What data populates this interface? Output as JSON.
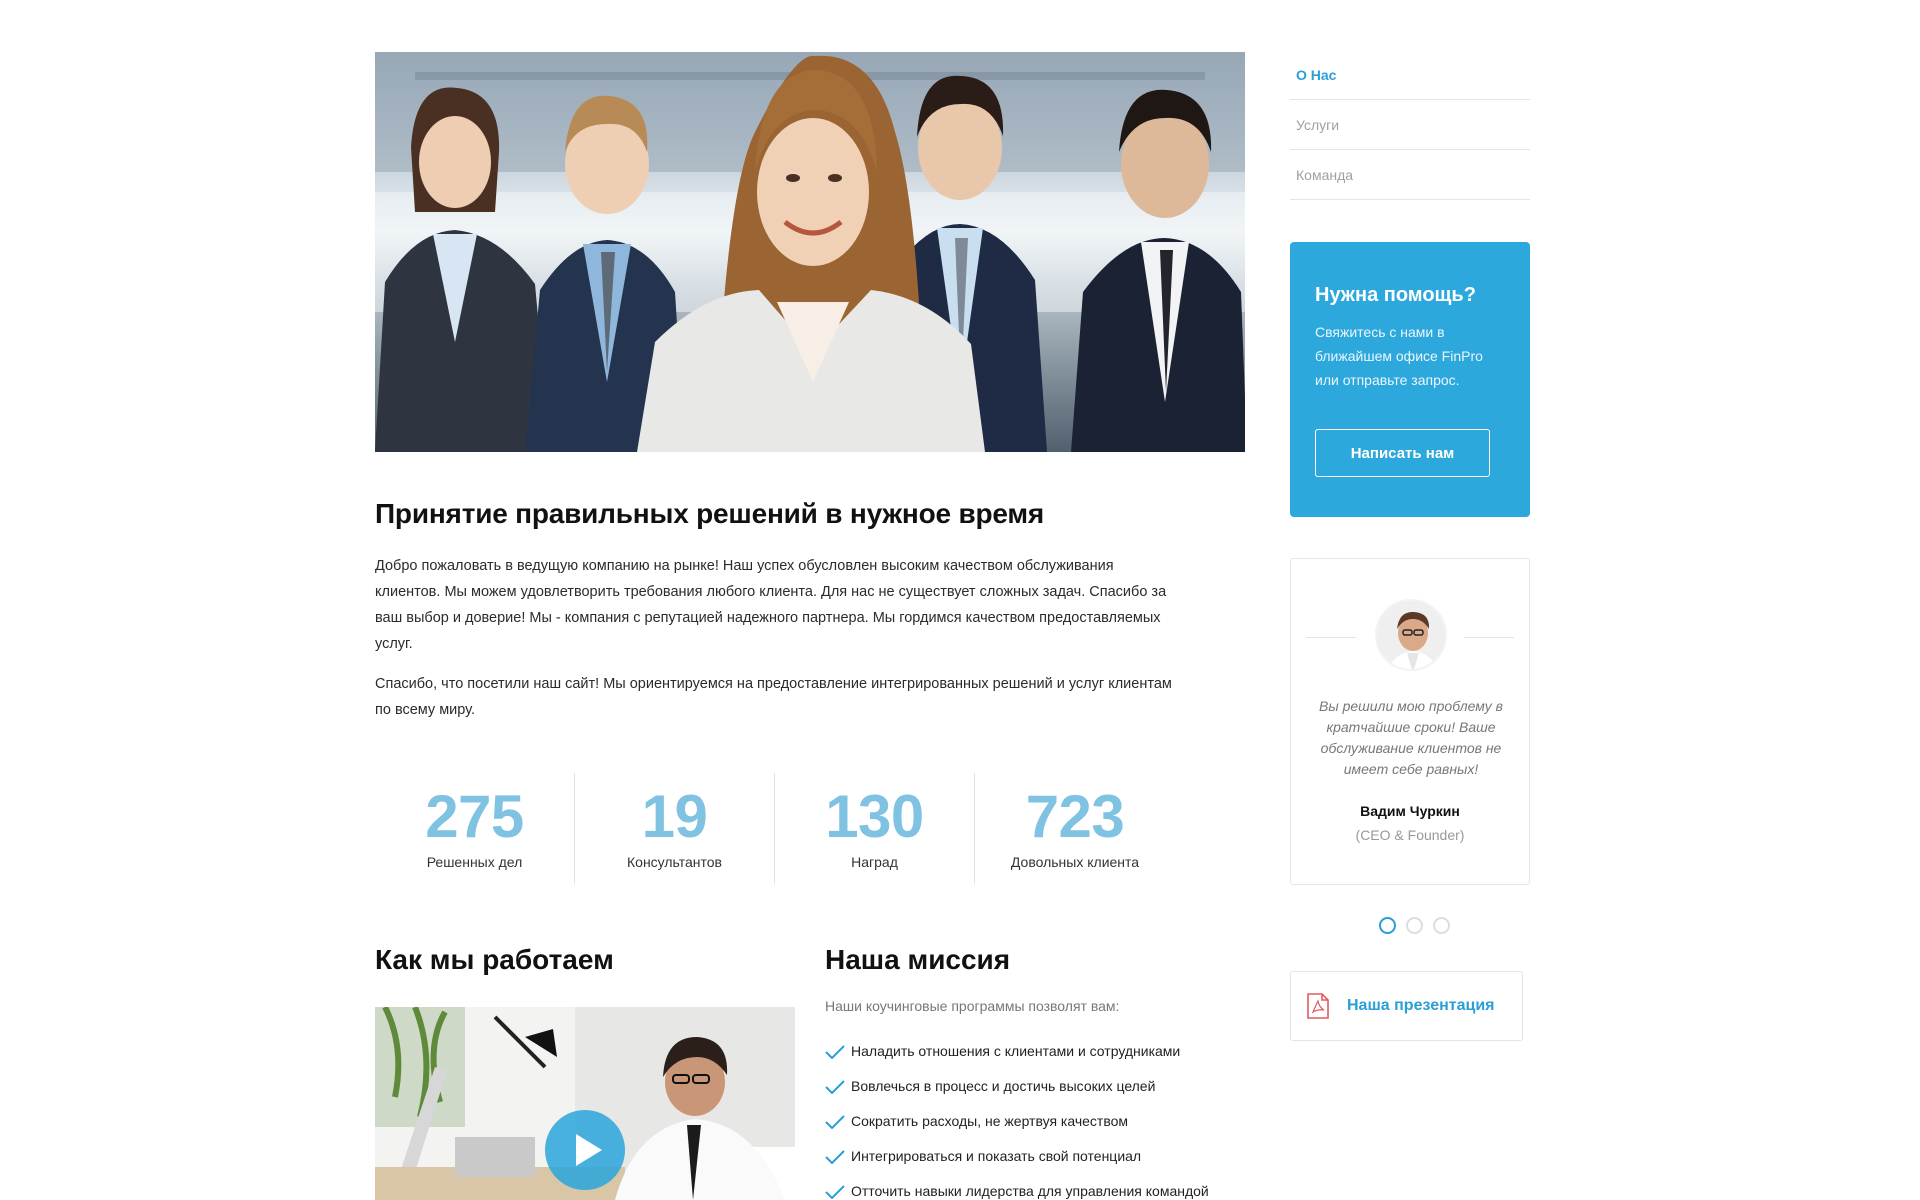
{
  "hero": {
    "image": "team-of-business-people-photo"
  },
  "article": {
    "headline": "Принятие правильных решений в нужное время",
    "paragraph_1": "Добро пожаловать в ведущую компанию на рынке! Наш успех обусловлен высоким качеством обслуживания клиентов. Мы можем удовлетворить требования любого клиента. Для нас не существует сложных задач. Спасибо за ваш выбор и доверие! Мы - компания с репутацией надежного партнера. Мы гордимся качеством предоставляемых услуг.",
    "paragraph_2": "Спасибо, что посетили наш сайт! Мы ориентируемся на предоставление интегрированных решений и услуг клиентам по всему миру."
  },
  "stats": [
    {
      "value": "275",
      "label": "Решенных дел"
    },
    {
      "value": "19",
      "label": "Консультантов"
    },
    {
      "value": "130",
      "label": "Наград"
    },
    {
      "value": "723",
      "label": "Довольных клиента"
    }
  ],
  "how_we_work": {
    "title": "Как мы работаем",
    "video_image": "man-working-at-desk-photo",
    "play_icon": "play-icon"
  },
  "mission": {
    "title": "Наша миссия",
    "intro": "Наши коучинговые программы позволят вам:",
    "items": [
      "Наладить отношения с клиентами и сотрудниками",
      "Вовлечься в процесс и достичь высоких целей",
      "Сократить расходы, не жертвуя качеством",
      "Интегрироваться и показать свой потенциал",
      "Отточить навыки лидерства для управления командой"
    ],
    "check_icon": "checkmark-icon"
  },
  "sidebar": {
    "nav": [
      {
        "label": "О Нас",
        "active": true
      },
      {
        "label": "Услуги",
        "active": false
      },
      {
        "label": "Команда",
        "active": false
      }
    ],
    "help": {
      "title": "Нужна помощь?",
      "text": "Свяжитесь с нами в ближайшем офисе FinPro или отправьте запрос.",
      "button": "Написать нам"
    },
    "testimonial": {
      "quote": "Вы решили мою проблему в кратчайшие сроки! Ваше обслуживание клиентов не имеет себе равных!",
      "author": "Вадим Чуркин",
      "role": "(CEO & Founder)",
      "slides_total": 3,
      "active_slide": 1
    },
    "presentation": {
      "label": "Наша презентация",
      "icon": "pdf-file-icon"
    }
  },
  "colors": {
    "accent": "#2da8dd",
    "stat_number": "#7fc2e1",
    "nav_active": "#2a9fd6",
    "muted_text": "#a0a0a0"
  }
}
